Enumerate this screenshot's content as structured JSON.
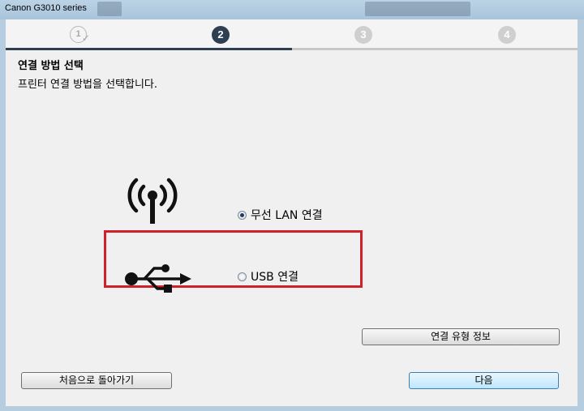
{
  "window": {
    "title": "Canon G3010 series"
  },
  "steps": {
    "items": [
      {
        "label": "1",
        "state": "done"
      },
      {
        "label": "2",
        "state": "current"
      },
      {
        "label": "3",
        "state": "pending"
      },
      {
        "label": "4",
        "state": "pending"
      }
    ]
  },
  "page": {
    "heading": "연결 방법 선택",
    "subheading": "프린터 연결 방법을 선택합니다."
  },
  "options": {
    "wireless_label": "무선 LAN 연결",
    "wireless_selected": true,
    "usb_label": "USB 연결",
    "usb_selected": false
  },
  "buttons": {
    "info_label": "연결 유형 정보",
    "back_label": "처음으로 돌아가기",
    "next_label": "다음"
  },
  "colors": {
    "accent": "#2f3f52",
    "highlight": "#d0202a"
  }
}
